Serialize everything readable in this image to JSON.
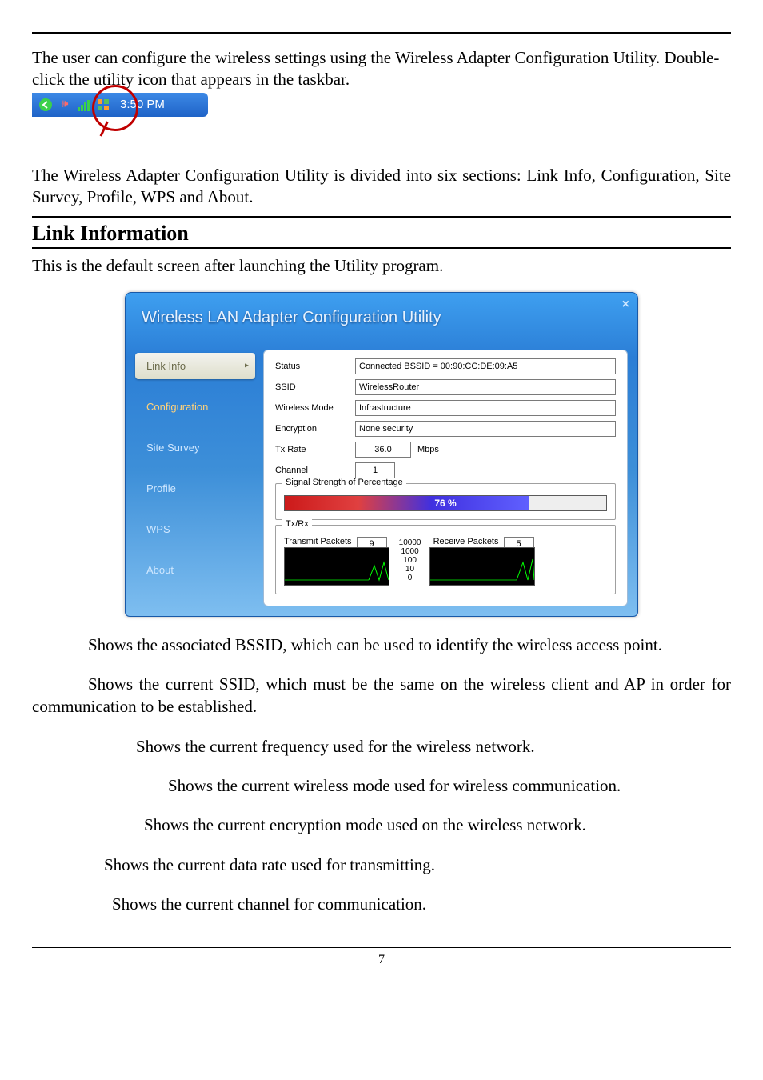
{
  "intro_text_1": "The user can configure the wireless settings using the Wireless Adapter Configuration Utility.  Double-click the utility icon that appears in the taskbar.",
  "tray": {
    "time": "3:50 PM"
  },
  "intro_text_2": "The Wireless Adapter Configuration Utility is divided into six sections: Link Info, Configuration, Site Survey, Profile, WPS and About.",
  "section_heading": "Link Information",
  "section_sub": "This is the default screen after launching the Utility program.",
  "utility": {
    "title": "Wireless LAN Adapter Configuration Utility",
    "close": "×",
    "nav": {
      "link_info": "Link Info",
      "configuration": "Configuration",
      "site_survey": "Site Survey",
      "profile": "Profile",
      "wps": "WPS",
      "about": "About"
    },
    "labels": {
      "status": "Status",
      "ssid": "SSID",
      "wireless_mode": "Wireless Mode",
      "encryption": "Encryption",
      "tx_rate": "Tx Rate",
      "tx_rate_unit": "Mbps",
      "channel": "Channel",
      "signal_legend": "Signal Strength of Percentage",
      "txrx_legend": "Tx/Rx",
      "transmit": "Transmit Packets",
      "receive": "Receive Packets"
    },
    "values": {
      "status": "Connected BSSID = 00:90:CC:DE:09:A5",
      "ssid": "WirelessRouter",
      "wireless_mode": "Infrastructure",
      "encryption": "None security",
      "tx_rate": "36.0",
      "channel": "1",
      "signal_percent": "76 %",
      "transmit": "9",
      "receive": "5",
      "scale": [
        "10000",
        "1000",
        "100",
        "10",
        "0"
      ]
    }
  },
  "descriptions": {
    "d1": "Shows the associated BSSID, which can be used to identify the wireless access point.",
    "d2": "Shows the current SSID, which must be the same on the wireless client and AP in order for communication to be established.",
    "d3": "Shows the current frequency used for the wireless network.",
    "d4": "Shows the current wireless mode used for wireless communication.",
    "d5": "Shows the current encryption mode used on the wireless network.",
    "d6": "Shows the current data rate used for transmitting.",
    "d7": "Shows the current channel for communication."
  },
  "page_number": "7"
}
